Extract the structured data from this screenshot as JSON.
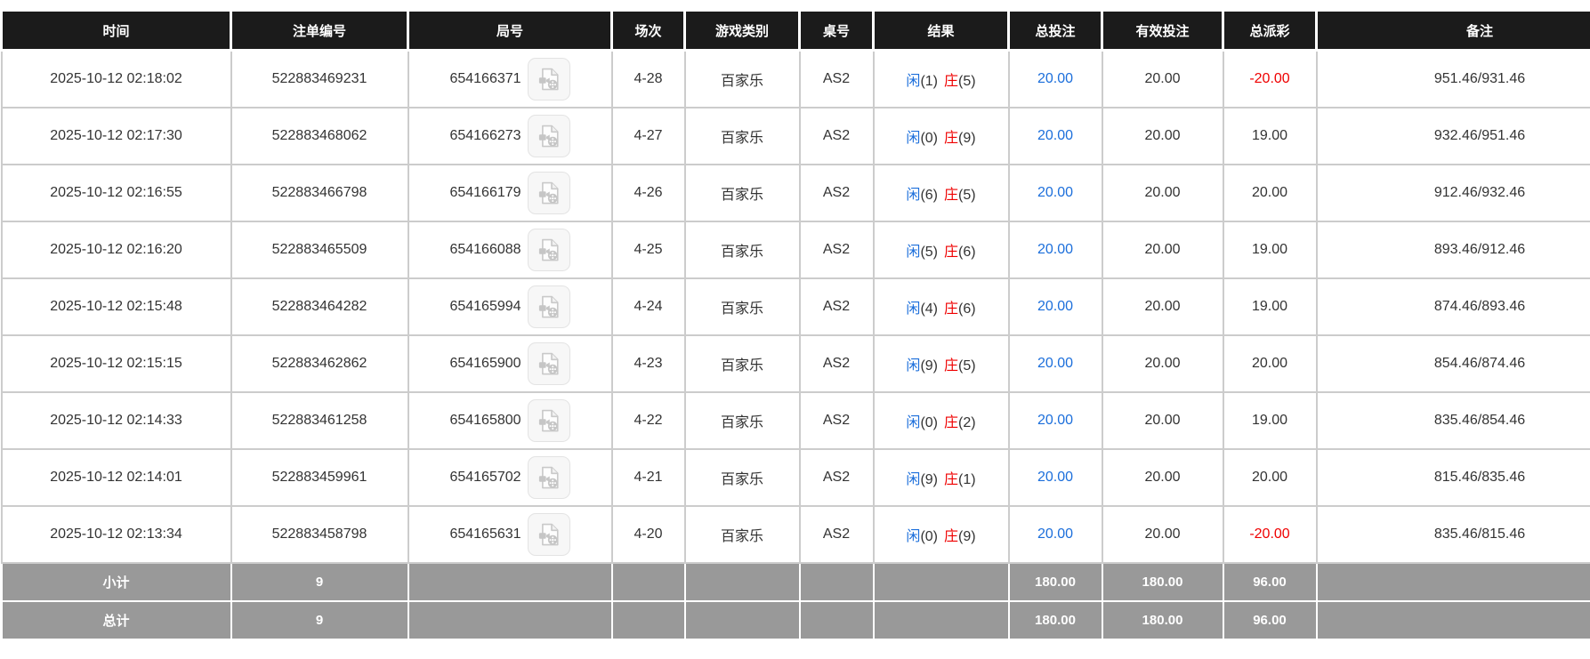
{
  "table": {
    "columns": [
      {
        "key": "time",
        "label": "时间"
      },
      {
        "key": "bet-id",
        "label": "注单编号"
      },
      {
        "key": "round",
        "label": "局号"
      },
      {
        "key": "session",
        "label": "场次"
      },
      {
        "key": "game-type",
        "label": "游戏类别"
      },
      {
        "key": "table-no",
        "label": "桌号"
      },
      {
        "key": "result",
        "label": "结果"
      },
      {
        "key": "total-bet",
        "label": "总投注"
      },
      {
        "key": "valid-bet",
        "label": "有效投注"
      },
      {
        "key": "payout",
        "label": "总派彩"
      },
      {
        "key": "remark",
        "label": "备注"
      }
    ],
    "video_icon_name": "video-replay-icon",
    "rows": [
      {
        "time": "2025-10-12 02:18:02",
        "bet_id": "522883469231",
        "round": "654166371",
        "session": "4-28",
        "game": "百家乐",
        "table_no": "AS2",
        "result": {
          "player": "闲",
          "player_score": "(1)",
          "banker": "庄",
          "banker_score": "(5)"
        },
        "total_bet": "20.00",
        "valid_bet": "20.00",
        "payout": "-20.00",
        "remark": "951.46/931.46"
      },
      {
        "time": "2025-10-12 02:17:30",
        "bet_id": "522883468062",
        "round": "654166273",
        "session": "4-27",
        "game": "百家乐",
        "table_no": "AS2",
        "result": {
          "player": "闲",
          "player_score": "(0)",
          "banker": "庄",
          "banker_score": "(9)"
        },
        "total_bet": "20.00",
        "valid_bet": "20.00",
        "payout": "19.00",
        "remark": "932.46/951.46"
      },
      {
        "time": "2025-10-12 02:16:55",
        "bet_id": "522883466798",
        "round": "654166179",
        "session": "4-26",
        "game": "百家乐",
        "table_no": "AS2",
        "result": {
          "player": "闲",
          "player_score": "(6)",
          "banker": "庄",
          "banker_score": "(5)"
        },
        "total_bet": "20.00",
        "valid_bet": "20.00",
        "payout": "20.00",
        "remark": "912.46/932.46"
      },
      {
        "time": "2025-10-12 02:16:20",
        "bet_id": "522883465509",
        "round": "654166088",
        "session": "4-25",
        "game": "百家乐",
        "table_no": "AS2",
        "result": {
          "player": "闲",
          "player_score": "(5)",
          "banker": "庄",
          "banker_score": "(6)"
        },
        "total_bet": "20.00",
        "valid_bet": "20.00",
        "payout": "19.00",
        "remark": "893.46/912.46"
      },
      {
        "time": "2025-10-12 02:15:48",
        "bet_id": "522883464282",
        "round": "654165994",
        "session": "4-24",
        "game": "百家乐",
        "table_no": "AS2",
        "result": {
          "player": "闲",
          "player_score": "(4)",
          "banker": "庄",
          "banker_score": "(6)"
        },
        "total_bet": "20.00",
        "valid_bet": "20.00",
        "payout": "19.00",
        "remark": "874.46/893.46"
      },
      {
        "time": "2025-10-12 02:15:15",
        "bet_id": "522883462862",
        "round": "654165900",
        "session": "4-23",
        "game": "百家乐",
        "table_no": "AS2",
        "result": {
          "player": "闲",
          "player_score": "(9)",
          "banker": "庄",
          "banker_score": "(5)"
        },
        "total_bet": "20.00",
        "valid_bet": "20.00",
        "payout": "20.00",
        "remark": "854.46/874.46"
      },
      {
        "time": "2025-10-12 02:14:33",
        "bet_id": "522883461258",
        "round": "654165800",
        "session": "4-22",
        "game": "百家乐",
        "table_no": "AS2",
        "result": {
          "player": "闲",
          "player_score": "(0)",
          "banker": "庄",
          "banker_score": "(2)"
        },
        "total_bet": "20.00",
        "valid_bet": "20.00",
        "payout": "19.00",
        "remark": "835.46/854.46"
      },
      {
        "time": "2025-10-12 02:14:01",
        "bet_id": "522883459961",
        "round": "654165702",
        "session": "4-21",
        "game": "百家乐",
        "table_no": "AS2",
        "result": {
          "player": "闲",
          "player_score": "(9)",
          "banker": "庄",
          "banker_score": "(1)"
        },
        "total_bet": "20.00",
        "valid_bet": "20.00",
        "payout": "20.00",
        "remark": "815.46/835.46"
      },
      {
        "time": "2025-10-12 02:13:34",
        "bet_id": "522883458798",
        "round": "654165631",
        "session": "4-20",
        "game": "百家乐",
        "table_no": "AS2",
        "result": {
          "player": "闲",
          "player_score": "(0)",
          "banker": "庄",
          "banker_score": "(9)"
        },
        "total_bet": "20.00",
        "valid_bet": "20.00",
        "payout": "-20.00",
        "remark": "835.46/815.46"
      }
    ],
    "totals": [
      {
        "key": "subtotal",
        "label": "小计",
        "count": "9",
        "total_bet": "180.00",
        "valid_bet": "180.00",
        "payout": "96.00"
      },
      {
        "key": "grand-total",
        "label": "总计",
        "count": "9",
        "total_bet": "180.00",
        "valid_bet": "180.00",
        "payout": "96.00"
      }
    ]
  },
  "colors": {
    "header_bg": "#1b1b1b",
    "footer_bg": "#999999",
    "accent_blue": "#1b6edb",
    "accent_red": "#ef0000",
    "body_text": "#333333"
  }
}
